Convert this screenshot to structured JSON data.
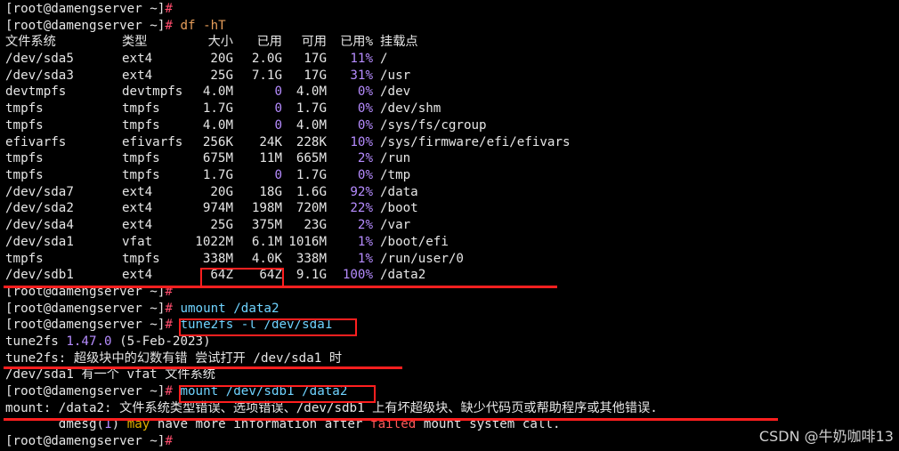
{
  "prompt": "[root@damengserver ~]",
  "prompt_symbol": "#",
  "commands": {
    "df": "df -hT",
    "umount": "umount /data2",
    "tune2fs": "tune2fs -l /dev/sda1",
    "mount": "mount /dev/sdb1 /data2"
  },
  "df_header": {
    "fs": "文件系统",
    "type": "类型",
    "size": "大小",
    "used": "已用",
    "avail": "可用",
    "usep": "已用%",
    "mount": "挂载点"
  },
  "df_rows": [
    {
      "fs": "/dev/sda5",
      "type": "ext4",
      "size": "20G",
      "used": "2.0G",
      "avail": "17G",
      "usep": "11%",
      "mount": "/"
    },
    {
      "fs": "/dev/sda3",
      "type": "ext4",
      "size": "25G",
      "used": "7.1G",
      "avail": "17G",
      "usep": "31%",
      "mount": "/usr"
    },
    {
      "fs": "devtmpfs",
      "type": "devtmpfs",
      "size": "4.0M",
      "used": "0",
      "avail": "4.0M",
      "usep": "0%",
      "mount": "/dev"
    },
    {
      "fs": "tmpfs",
      "type": "tmpfs",
      "size": "1.7G",
      "used": "0",
      "avail": "1.7G",
      "usep": "0%",
      "mount": "/dev/shm"
    },
    {
      "fs": "tmpfs",
      "type": "tmpfs",
      "size": "4.0M",
      "used": "0",
      "avail": "4.0M",
      "usep": "0%",
      "mount": "/sys/fs/cgroup"
    },
    {
      "fs": "efivarfs",
      "type": "efivarfs",
      "size": "256K",
      "used": "24K",
      "avail": "228K",
      "usep": "10%",
      "mount": "/sys/firmware/efi/efivars"
    },
    {
      "fs": "tmpfs",
      "type": "tmpfs",
      "size": "675M",
      "used": "11M",
      "avail": "665M",
      "usep": "2%",
      "mount": "/run"
    },
    {
      "fs": "tmpfs",
      "type": "tmpfs",
      "size": "1.7G",
      "used": "0",
      "avail": "1.7G",
      "usep": "0%",
      "mount": "/tmp"
    },
    {
      "fs": "/dev/sda7",
      "type": "ext4",
      "size": "20G",
      "used": "18G",
      "avail": "1.6G",
      "usep": "92%",
      "mount": "/data"
    },
    {
      "fs": "/dev/sda2",
      "type": "ext4",
      "size": "974M",
      "used": "198M",
      "avail": "720M",
      "usep": "22%",
      "mount": "/boot"
    },
    {
      "fs": "/dev/sda4",
      "type": "ext4",
      "size": "25G",
      "used": "375M",
      "avail": "23G",
      "usep": "2%",
      "mount": "/var"
    },
    {
      "fs": "/dev/sda1",
      "type": "vfat",
      "size": "1022M",
      "used": "6.1M",
      "avail": "1016M",
      "usep": "1%",
      "mount": "/boot/efi"
    },
    {
      "fs": "tmpfs",
      "type": "tmpfs",
      "size": "338M",
      "used": "4.0K",
      "avail": "338M",
      "usep": "1%",
      "mount": "/run/user/0"
    },
    {
      "fs": "/dev/sdb1",
      "type": "ext4",
      "size": "64Z",
      "used": "64Z",
      "avail": "9.1G",
      "usep": "100%",
      "mount": "/data2"
    }
  ],
  "tune2fs_version_prefix": "tune2fs ",
  "tune2fs_version": "1.47.0",
  "tune2fs_date": " (5-Feb-2023)",
  "tune2fs_error_label": "tune2fs:",
  "tune2fs_error_msg": " 超级块中的幻数有错 尝试打开 /dev/sda1 时",
  "sda1_note": "/dev/sda1 有一个 vfat 文件系统",
  "mount_error_label": "mount: /data2:",
  "mount_error_msg": " 文件系统类型错误、选项错误、/dev/sdb1 上有坏超级块、缺少代码页或帮助程序或其他错误.",
  "dmesg_prefix": "       dmesg(",
  "dmesg_num": "1",
  "dmesg_close": ") ",
  "dmesg_may": "may",
  "dmesg_mid": " have more information after ",
  "dmesg_failed": "failed",
  "dmesg_end": " mount system call.",
  "watermark": "CSDN @牛奶咖啡13",
  "colors": {
    "background": "#000000",
    "text": "#e6e6e6",
    "highlight_box": "#ff1f1f",
    "percent": "#b68cff",
    "cursor": "#ff4d6d"
  }
}
